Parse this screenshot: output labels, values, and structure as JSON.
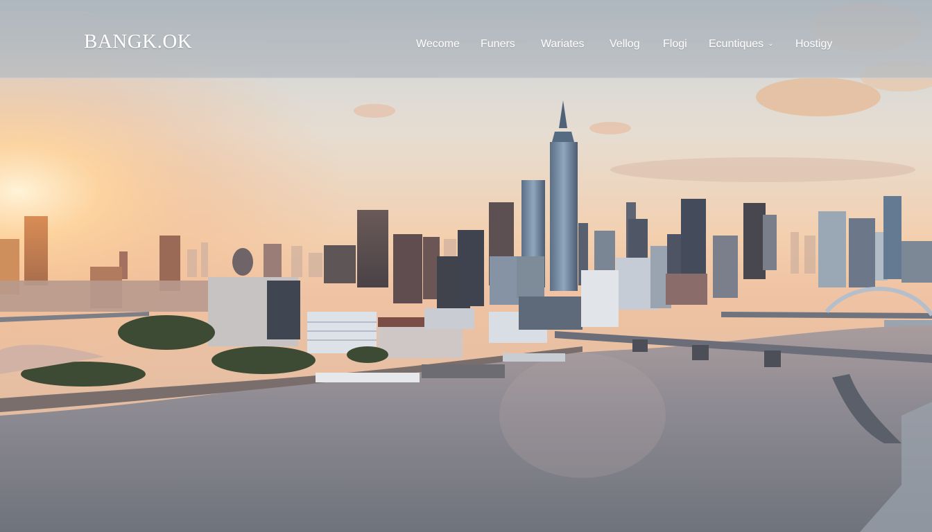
{
  "header": {
    "logo": "BANGK.OK"
  },
  "nav": {
    "items": [
      {
        "label": "Wecome"
      },
      {
        "label": "Funers"
      },
      {
        "label": "Wariates"
      },
      {
        "label": "Vellog"
      },
      {
        "label": "Flogi"
      },
      {
        "label": "Ecuntiques",
        "has_dropdown": true,
        "icon": "chevron-down-icon",
        "chevron": "⌄"
      },
      {
        "label": "Hostigy"
      }
    ]
  },
  "hero": {
    "image": "bangkok-skyline-sunset"
  }
}
